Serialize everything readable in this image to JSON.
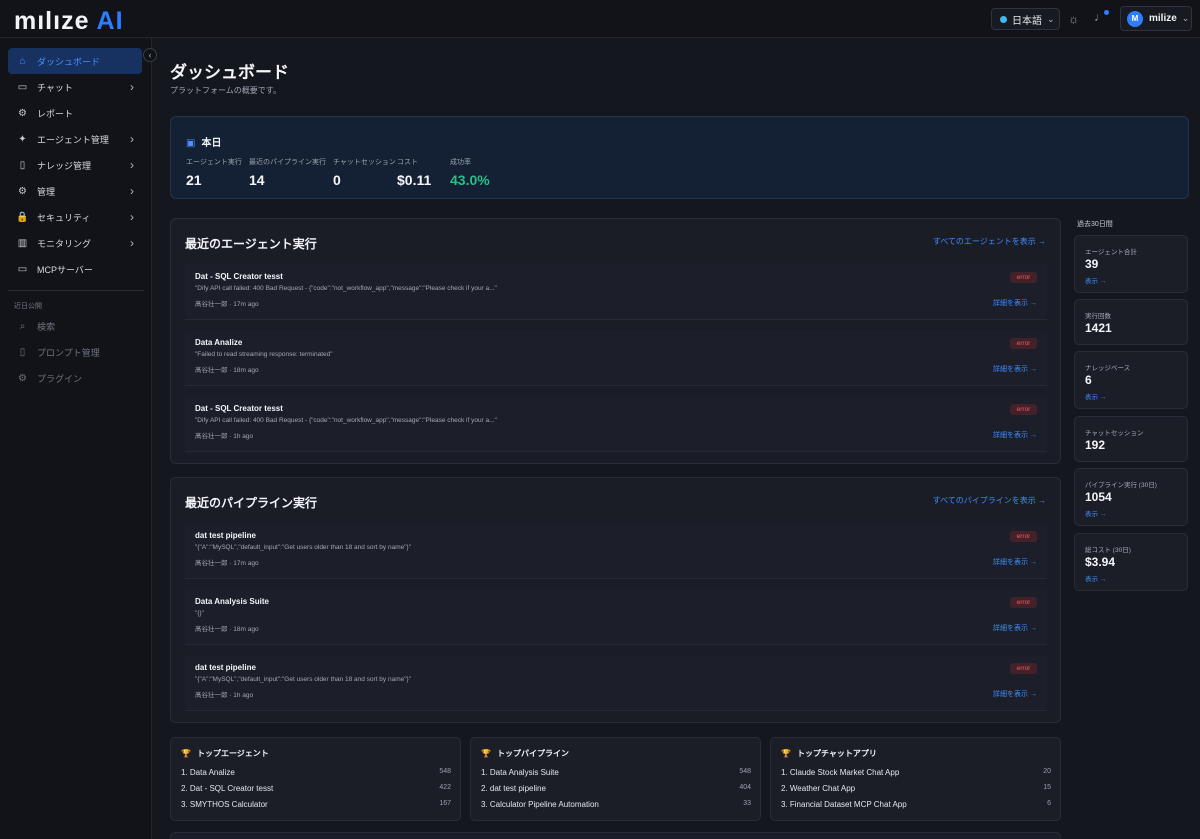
{
  "app": {
    "logo_text_a": "mılıze",
    "logo_text_b": "AI"
  },
  "header": {
    "language": "日本語",
    "language_chevron": "⌄",
    "theme_icon": "sun-icon",
    "notification_icon": "bell-icon",
    "user_initial": "M",
    "user_name": "milize",
    "user_chevron": "⌄"
  },
  "sidebar": {
    "collapse_icon": "‹",
    "items": [
      {
        "label": "ダッシュボード",
        "icon": "⌂",
        "active": true,
        "arrow": ""
      },
      {
        "label": "チャット",
        "icon": "▭",
        "arrow": "›"
      },
      {
        "label": "レポート",
        "icon": "⚙",
        "arrow": ""
      },
      {
        "label": "エージェント管理",
        "icon": "✦",
        "arrow": "›"
      },
      {
        "label": "ナレッジ管理",
        "icon": "▯",
        "arrow": "›"
      },
      {
        "label": "管理",
        "icon": "⚙",
        "arrow": "›"
      },
      {
        "label": "セキュリティ",
        "icon": "🔒",
        "arrow": "›"
      },
      {
        "label": "モニタリング",
        "icon": "▥",
        "arrow": "›"
      },
      {
        "label": "MCPサーバー",
        "icon": "▭",
        "arrow": ""
      }
    ],
    "coming_soon_label": "近日公開",
    "disabled_items": [
      {
        "label": "検索",
        "icon": "⌕"
      },
      {
        "label": "プロンプト管理",
        "icon": "▯"
      },
      {
        "label": "プラグイン",
        "icon": "⚙"
      }
    ]
  },
  "page": {
    "title": "ダッシュボード",
    "subtitle": "プラットフォームの概要です。"
  },
  "today": {
    "title": "本日",
    "calendar_icon": "▣",
    "metrics": [
      {
        "label": "エージェント実行",
        "value": "21"
      },
      {
        "label": "最近のパイプライン実行",
        "value": "14"
      },
      {
        "label": "チャットセッション",
        "value": "0"
      },
      {
        "label": "コスト",
        "value": "$0.11"
      },
      {
        "label": "成功率",
        "value": "43.0%"
      }
    ]
  },
  "recent_agents": {
    "title": "最近のエージェント実行",
    "view_all": "すべてのエージェントを表示 →",
    "items": [
      {
        "name": "Dat - SQL Creator tesst",
        "message": "\"Dify API call failed: 400 Bad Request - {\"code\":\"not_workflow_app\",\"message\":\"Please check if your a...\"",
        "meta": "髙谷壮一郎 · 17m ago",
        "status": "error",
        "details": "詳細を表示 →"
      },
      {
        "name": "Data Analize",
        "message": "\"Failed to read streaming response: terminated\"",
        "meta": "髙谷壮一郎 · 18m ago",
        "status": "error",
        "details": "詳細を表示 →"
      },
      {
        "name": "Dat - SQL Creator tesst",
        "message": "\"Dify API call failed: 400 Bad Request - {\"code\":\"not_workflow_app\",\"message\":\"Please check if your a...\"",
        "meta": "髙谷壮一郎 · 1h ago",
        "status": "error",
        "details": "詳細を表示 →"
      }
    ]
  },
  "recent_pipelines": {
    "title": "最近のパイプライン実行",
    "view_all": "すべてのパイプラインを表示 →",
    "items": [
      {
        "name": "dat test pipeline",
        "message": "\"{\"A\":\"MySQL\",\"default_input\":\"Get users older than 18 and sort by name\"}\"",
        "meta": "髙谷壮一郎 · 17m ago",
        "status": "error",
        "details": "詳細を表示 →"
      },
      {
        "name": "Data Analysis Suite",
        "message": "\"{}\"",
        "meta": "髙谷壮一郎 · 18m ago",
        "status": "error",
        "details": "詳細を表示 →"
      },
      {
        "name": "dat test pipeline",
        "message": "\"{\"A\":\"MySQL\",\"default_input\":\"Get users older than 18 and sort by name\"}\"",
        "meta": "髙谷壮一郎 · 1h ago",
        "status": "error",
        "details": "詳細を表示 →"
      }
    ]
  },
  "right_panel": {
    "title": "過去30日間",
    "stats": [
      {
        "label": "エージェント合計",
        "value": "39",
        "link": "表示 →"
      },
      {
        "label": "実行回数",
        "value": "1421",
        "link": ""
      },
      {
        "label": "ナレッジベース",
        "value": "6",
        "link": "表示 →"
      },
      {
        "label": "チャットセッション",
        "value": "192",
        "link": ""
      },
      {
        "label": "パイプライン実行 (30日)",
        "value": "1054",
        "link": "表示 →"
      },
      {
        "label": "総コスト (30日)",
        "value": "$3.94",
        "link": "表示 →"
      }
    ]
  },
  "top_lists": [
    {
      "title": "トップエージェント",
      "rows": [
        {
          "label": "1. Data Analize",
          "value": "548"
        },
        {
          "label": "2. Dat - SQL Creator tesst",
          "value": "422"
        },
        {
          "label": "3. SMYTHOS Calculator",
          "value": "167"
        }
      ]
    },
    {
      "title": "トップパイプライン",
      "rows": [
        {
          "label": "1. Data Analysis Suite",
          "value": "548"
        },
        {
          "label": "2. dat test pipeline",
          "value": "404"
        },
        {
          "label": "3. Calculator Pipeline Automation",
          "value": "33"
        }
      ]
    },
    {
      "title": "トップチャットアプリ",
      "rows": [
        {
          "label": "1. Claude Stock Market Chat App",
          "value": "20"
        },
        {
          "label": "2. Weather Chat App",
          "value": "15"
        },
        {
          "label": "3. Financial Dataset MCP Chat App",
          "value": "6"
        }
      ]
    }
  ],
  "colors": {
    "accent": "#2f7dff",
    "success": "#27bf87",
    "error": "#f05a65",
    "background": "#15171f"
  }
}
